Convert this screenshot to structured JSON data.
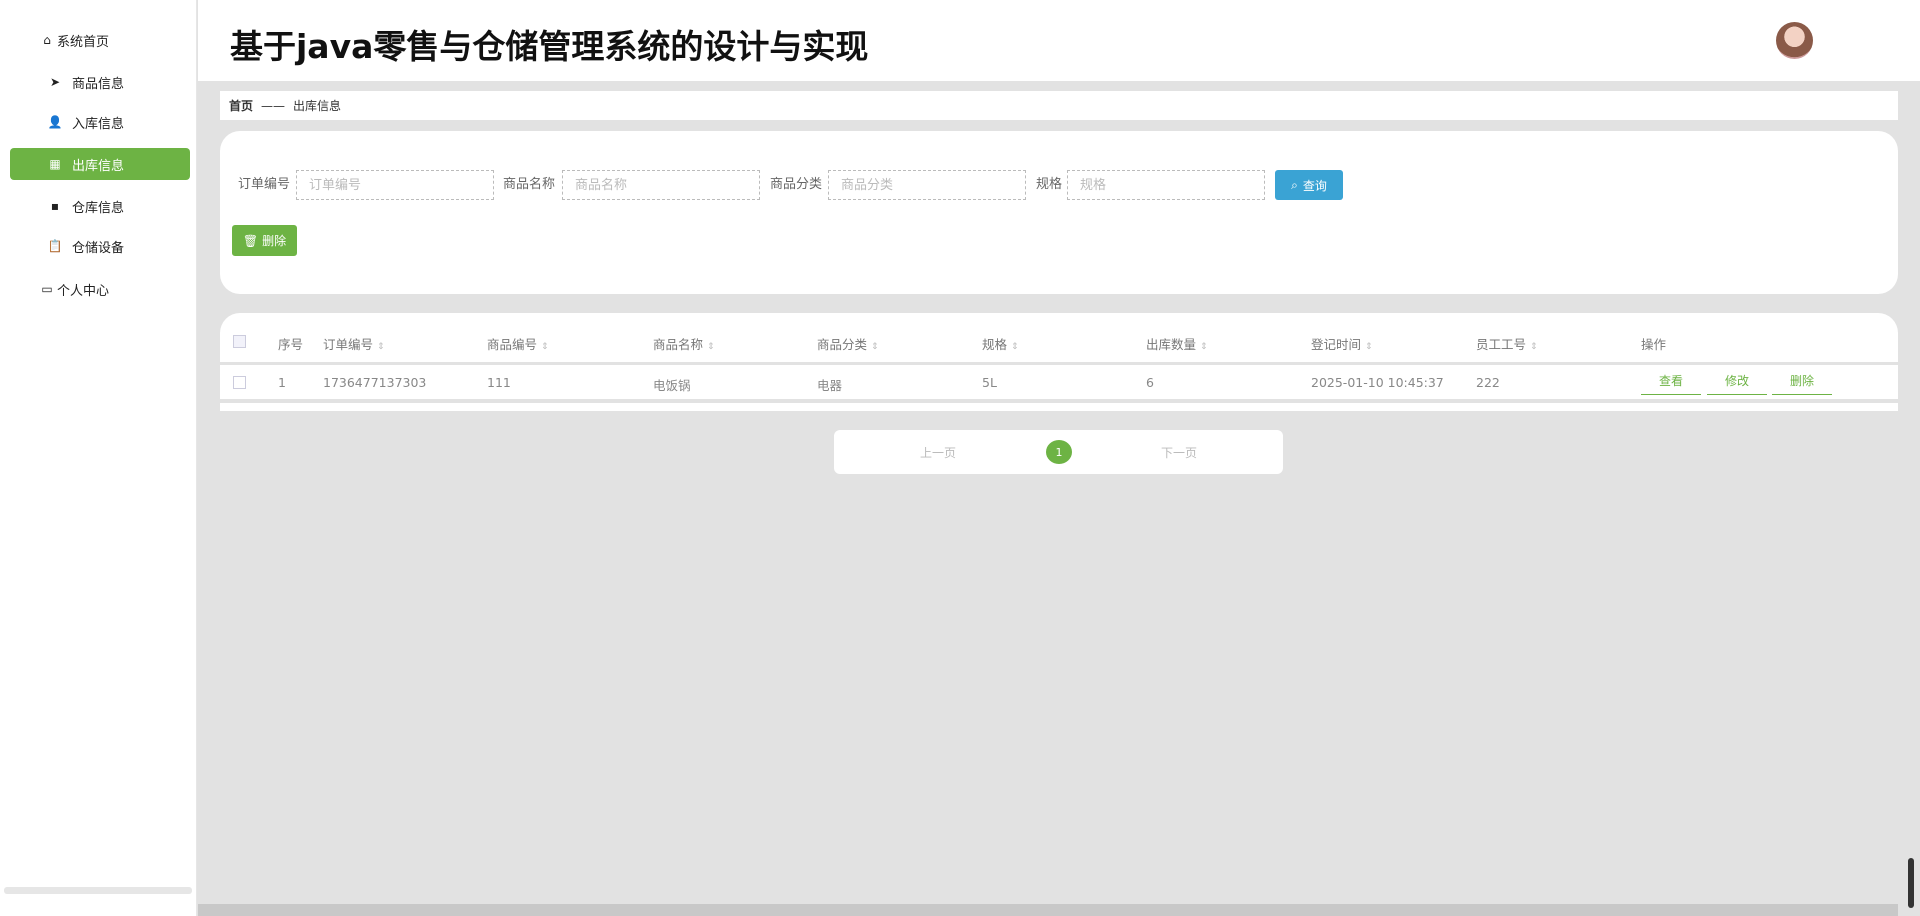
{
  "header": {
    "title": "基于java零售与仓储管理系统的设计与实现"
  },
  "sidebar": {
    "items": [
      {
        "label": "系统首页",
        "icon": "home-icon"
      },
      {
        "label": "商品信息",
        "icon": "send-icon"
      },
      {
        "label": "入库信息",
        "icon": "user-icon"
      },
      {
        "label": "出库信息",
        "icon": "grid-icon",
        "active": true
      },
      {
        "label": "仓库信息",
        "icon": "apps-icon"
      },
      {
        "label": "仓储设备",
        "icon": "clipboard-icon"
      },
      {
        "label": "个人中心",
        "icon": "wallet-icon"
      }
    ]
  },
  "breadcrumb": {
    "home": "首页",
    "sep": "——",
    "current": "出库信息"
  },
  "search": {
    "fields": [
      {
        "label": "订单编号",
        "placeholder": "订单编号"
      },
      {
        "label": "商品名称",
        "placeholder": "商品名称"
      },
      {
        "label": "商品分类",
        "placeholder": "商品分类"
      },
      {
        "label": "规格",
        "placeholder": "规格"
      }
    ],
    "query_label": "查询",
    "delete_label": "删除"
  },
  "table": {
    "columns": [
      "序号",
      "订单编号",
      "商品编号",
      "商品名称",
      "商品分类",
      "规格",
      "出库数量",
      "登记时间",
      "员工工号",
      "操作"
    ],
    "rows": [
      [
        "1",
        "1736477137303",
        "111",
        "电饭锅",
        "电器",
        "5L",
        "6",
        "2025-01-10 10:45:37",
        "222"
      ]
    ],
    "actions": [
      "查看",
      "修改",
      "删除"
    ]
  },
  "pagination": {
    "prev": "上一页",
    "page": "1",
    "next": "下一页"
  },
  "colors": {
    "accent": "#6db344",
    "query": "#3aa3d4"
  }
}
